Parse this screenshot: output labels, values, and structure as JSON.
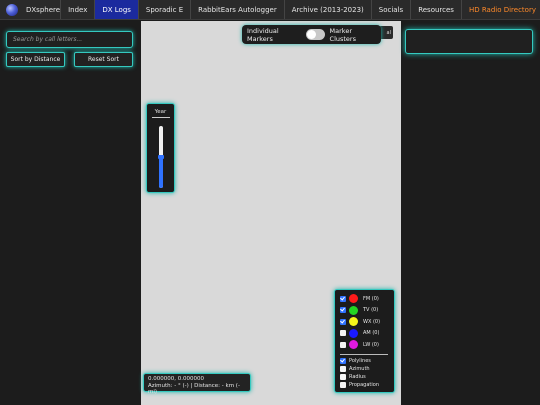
{
  "nav": {
    "brand": "DXsphere",
    "tabs": [
      {
        "label": "Index"
      },
      {
        "label": "DX Logs"
      },
      {
        "label": "Sporadic E"
      },
      {
        "label": "RabbitEars Autologger"
      },
      {
        "label": "Archive (2013-2023)"
      },
      {
        "label": "Socials"
      },
      {
        "label": "Resources"
      },
      {
        "label": "HD Radio Directory"
      }
    ],
    "active_tab": "DX Logs",
    "icons": {
      "brand": "globe-icon",
      "hd": "radio-icon"
    }
  },
  "sidebar": {
    "search_placeholder": "Search by call letters...",
    "sort_button": "Sort by Distance",
    "reset_button": "Reset Sort"
  },
  "map": {
    "toggle": {
      "left": "Individual Markers",
      "right": "Marker Clusters"
    },
    "year_panel": {
      "label": "Year",
      "level": 0.5
    },
    "coords": {
      "line1": "0.000000, 0.000000",
      "line2": "Azimuth: - ° (-) | Distance: - km (- mi)"
    },
    "legend": {
      "bands": [
        {
          "label": "FM (0)",
          "color": "#ff1a1a",
          "checked": true
        },
        {
          "label": "TV (0)",
          "color": "#22d622",
          "checked": true
        },
        {
          "label": "WX (0)",
          "color": "#f5f51a",
          "checked": true
        },
        {
          "label": "AM (0)",
          "color": "#1a1aff",
          "checked": false
        },
        {
          "label": "LW (0)",
          "color": "#e01ae0",
          "checked": false
        }
      ],
      "options": [
        {
          "label": "Polylines",
          "checked": true
        },
        {
          "label": "Azimuth",
          "checked": false
        },
        {
          "label": "Radius",
          "checked": false
        },
        {
          "label": "Propagation",
          "checked": false
        }
      ]
    }
  },
  "colors": {
    "accent": "#35c9c0",
    "active_tab": "#1b2a9e",
    "hd_tab": "#ff8a2a"
  }
}
